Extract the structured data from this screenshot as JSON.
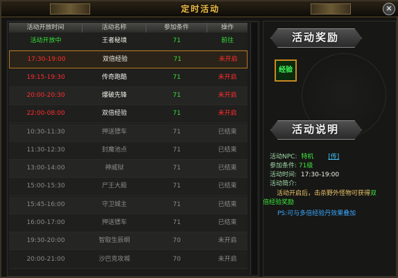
{
  "window": {
    "title": "定时活动",
    "close_label": "✕"
  },
  "table": {
    "headers": [
      "活动开放时间",
      "活动名称",
      "参加条件",
      "操作"
    ],
    "rows": [
      {
        "time": "活动开放中",
        "name": "王者秘境",
        "level": "71",
        "op": "前往",
        "time_color": "green",
        "name_color": "white",
        "level_color": "green",
        "op_color": "green"
      },
      {
        "time": "17:30-19:00",
        "name": "双倍经验",
        "level": "71",
        "op": "未开启",
        "time_color": "red",
        "name_color": "white",
        "level_color": "green",
        "op_color": "red",
        "selected": true
      },
      {
        "time": "19:15-19:30",
        "name": "传奇跑酷",
        "level": "71",
        "op": "未开启",
        "time_color": "red",
        "name_color": "white",
        "level_color": "green",
        "op_color": "red"
      },
      {
        "time": "20:00-20:30",
        "name": "爆破先锋",
        "level": "71",
        "op": "未开启",
        "time_color": "red",
        "name_color": "white",
        "level_color": "green",
        "op_color": "red"
      },
      {
        "time": "22:00-08:00",
        "name": "双倍经验",
        "level": "71",
        "op": "未开启",
        "time_color": "red",
        "name_color": "white",
        "level_color": "green",
        "op_color": "red"
      },
      {
        "time": "10:30-11:30",
        "name": "押送镖车",
        "level": "71",
        "op": "已结束",
        "time_color": "gray",
        "name_color": "gray",
        "level_color": "gray",
        "op_color": "gray"
      },
      {
        "time": "11:30-12:30",
        "name": "封魔池点",
        "level": "71",
        "op": "已结束",
        "time_color": "gray",
        "name_color": "gray",
        "level_color": "gray",
        "op_color": "gray"
      },
      {
        "time": "13:00-14:00",
        "name": "神威狱",
        "level": "71",
        "op": "已结束",
        "time_color": "gray",
        "name_color": "gray",
        "level_color": "gray",
        "op_color": "gray"
      },
      {
        "time": "15:00-15:30",
        "name": "尸王大殿",
        "level": "71",
        "op": "已结束",
        "time_color": "gray",
        "name_color": "gray",
        "level_color": "gray",
        "op_color": "gray"
      },
      {
        "time": "15:45-16:00",
        "name": "守卫城主",
        "level": "71",
        "op": "已结束",
        "time_color": "gray",
        "name_color": "gray",
        "level_color": "gray",
        "op_color": "gray"
      },
      {
        "time": "16:00-17:00",
        "name": "押送镖车",
        "level": "71",
        "op": "已结束",
        "time_color": "gray",
        "name_color": "gray",
        "level_color": "gray",
        "op_color": "gray"
      },
      {
        "time": "19:30-20:00",
        "name": "智取生辰纲",
        "level": "70",
        "op": "未开启",
        "time_color": "gray",
        "name_color": "gray",
        "level_color": "gray",
        "op_color": "gray"
      },
      {
        "time": "20:00-21:00",
        "name": "沙巴克攻城",
        "level": "70",
        "op": "未开启",
        "time_color": "gray",
        "name_color": "gray",
        "level_color": "gray",
        "op_color": "gray"
      }
    ]
  },
  "reward": {
    "banner": "活动奖励",
    "item_label": "经验"
  },
  "description": {
    "banner": "活动说明",
    "npc_label": "活动NPC:",
    "npc_name": "特机",
    "npc_link": "[传]",
    "cond_label": "参加条件:",
    "cond_value": "71级",
    "time_label": "活动时间:",
    "time_value": "17:30-19:00",
    "intro_label": "活动简介:",
    "intro_text": "活动开启后，击杀野外怪物可获得",
    "intro_highlight1": "双",
    "intro_highlight2": "倍经验奖励",
    "ps_text": "PS:可与多倍经验丹效果叠加"
  },
  "colors": {
    "title": "#f0c048",
    "accent_green": "#36e036",
    "accent_red": "#ff2e2e",
    "border_gold": "#b47a22"
  }
}
